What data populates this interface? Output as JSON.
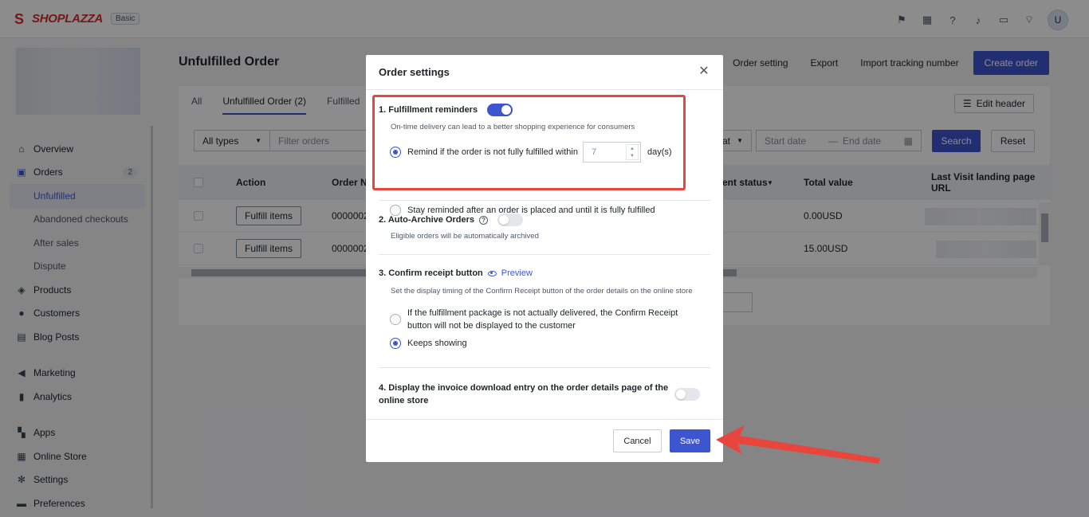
{
  "topbar": {
    "logo_text": "SHOPLAZZA",
    "plan_badge": "Basic",
    "avatar_letter": "U",
    "icons": [
      "flag-icon",
      "store-icon",
      "help-icon",
      "bell-icon",
      "message-icon",
      "wifi-icon"
    ]
  },
  "sidebar": {
    "items": [
      {
        "label": "Overview",
        "icon": "home-icon"
      },
      {
        "label": "Orders",
        "icon": "orders-icon",
        "badge": "2"
      },
      {
        "label": "Unfulfilled",
        "sub": true,
        "active": true
      },
      {
        "label": "Abandoned checkouts",
        "sub": true
      },
      {
        "label": "After sales",
        "sub": true
      },
      {
        "label": "Dispute",
        "sub": true
      },
      {
        "label": "Products",
        "icon": "products-icon"
      },
      {
        "label": "Customers",
        "icon": "customers-icon"
      },
      {
        "label": "Blog Posts",
        "icon": "blog-icon"
      },
      {
        "label": "Marketing",
        "icon": "marketing-icon"
      },
      {
        "label": "Analytics",
        "icon": "analytics-icon"
      },
      {
        "label": "Apps",
        "icon": "apps-icon"
      },
      {
        "label": "Online Store",
        "icon": "online-store-icon"
      },
      {
        "label": "Settings",
        "icon": "settings-icon"
      },
      {
        "label": "Preferences",
        "icon": "preferences-icon"
      }
    ]
  },
  "page": {
    "title": "Unfulfilled Order",
    "header_links": [
      "Order setting",
      "Export",
      "Import tracking number"
    ],
    "create_button": "Create order",
    "tabs": [
      "All",
      "Unfulfilled Order  (2)",
      "Fulfilled"
    ],
    "edit_header": "Edit header",
    "filters": {
      "type_select": "All types",
      "search_placeholder": "Filter orders",
      "format_select_partial": "at",
      "start_date": "Start date",
      "end_date": "End date",
      "search_button": "Search",
      "reset_button": "Reset"
    },
    "table": {
      "columns": [
        "Action",
        "Order N",
        "ent status",
        "Total value",
        "Last Visit landing page URL"
      ],
      "rows": [
        {
          "action": "Fulfill items",
          "order_no": "0000002",
          "total": "0.00USD"
        },
        {
          "action": "Fulfill items",
          "order_no": "0000002",
          "total": "15.00USD"
        }
      ]
    }
  },
  "modal": {
    "title": "Order settings",
    "section1": {
      "title": "1. Fulfillment reminders",
      "toggle_on": true,
      "desc": "On-time delivery can lead to a better shopping experience for consumers",
      "option1_prefix": "Remind if the order is not fully fulfilled within",
      "days_value": "7",
      "option1_suffix": "day(s)",
      "option2": "Stay reminded after an order is placed and until it is fully fulfilled"
    },
    "section2": {
      "title": "2. Auto-Archive Orders",
      "toggle_on": false,
      "desc": "Eligible orders will be automatically archived"
    },
    "section3": {
      "title": "3. Confirm receipt button",
      "preview": "Preview",
      "desc": "Set the display timing of the Confirm Receipt button of the order details on the online store",
      "option1_line1": "If the fulfillment package is not actually delivered, the Confirm Receipt",
      "option1_line2": "button will not be displayed to the customer",
      "option2": "Keeps showing"
    },
    "section4": {
      "title_line1": "4. Display the invoice download entry on the order details page of the",
      "title_line2": "online store",
      "toggle_on": false
    },
    "cancel": "Cancel",
    "save": "Save"
  },
  "colors": {
    "primary": "#3e55d0",
    "annotation": "#e8453c"
  }
}
